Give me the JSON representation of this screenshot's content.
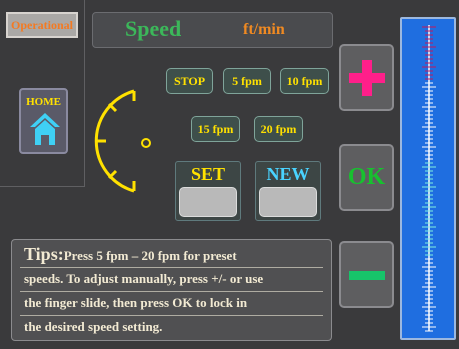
{
  "status": {
    "label": "Operational"
  },
  "home": {
    "label": "HOME"
  },
  "speed": {
    "title": "Speed",
    "unit": "ft/min"
  },
  "presets": {
    "stop": "STOP",
    "p5": "5 fpm",
    "p10": "10 fpm",
    "p15": "15 fpm",
    "p20": "20 fpm"
  },
  "buttons": {
    "set": "SET",
    "new": "NEW",
    "ok": "OK"
  },
  "tips": {
    "heading": "Tips:",
    "line1": "Press 5 fpm – 20 fpm for preset",
    "line2": "speeds. To adjust manually, press +/- or use",
    "line3": "the finger slide, then press OK to lock in",
    "line4": "the desired speed setting."
  },
  "colors": {
    "accent_yellow": "#ffe100",
    "speed_green": "#3cb75a",
    "unit_orange": "#f08a22",
    "plus_pink": "#ff1f8a",
    "minus_green": "#17c46a",
    "ok_green": "#17c12f",
    "slider_blue": "#1f6ee0"
  },
  "icons": {
    "home": "house-icon",
    "plus": "plus-icon",
    "minus": "minus-icon",
    "gauge": "speed-gauge-arc"
  }
}
